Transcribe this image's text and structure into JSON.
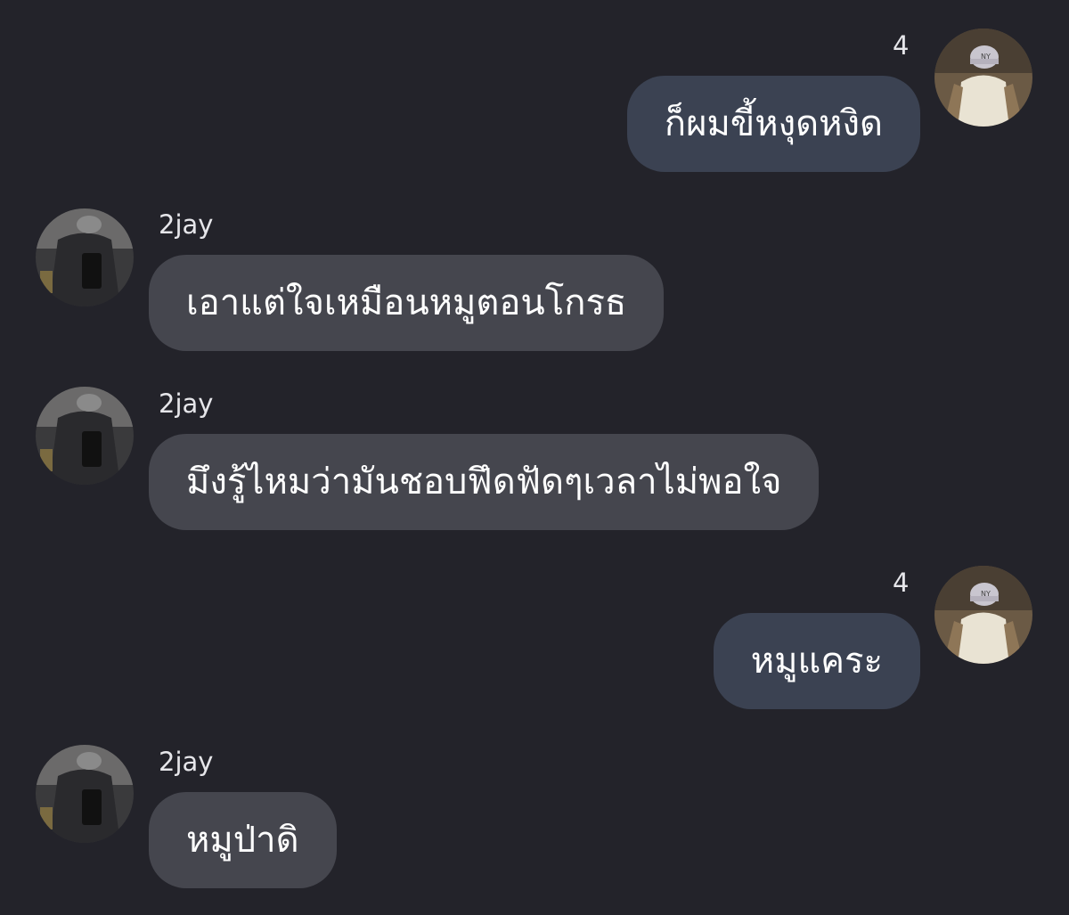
{
  "messages": [
    {
      "id": "m1",
      "side": "out",
      "sender": "4",
      "text": "ก็ผมขี้หงุดหงิด"
    },
    {
      "id": "m2",
      "side": "in",
      "sender": "2jay",
      "text": "เอาแต่ใจเหมือนหมูตอนโกรธ"
    },
    {
      "id": "m3",
      "side": "in",
      "sender": "2jay",
      "text": "มึงรู้ไหมว่ามันชอบฟึดฟัดๆเวลาไม่พอใจ"
    },
    {
      "id": "m4",
      "side": "out",
      "sender": "4",
      "text": "หมูแคระ"
    },
    {
      "id": "m5",
      "side": "in",
      "sender": "2jay",
      "text": "หมูป่าดิ"
    }
  ],
  "colors": {
    "background": "#23232a",
    "incoming_bubble": "#45464e",
    "outgoing_bubble": "#3b4252",
    "text": "#ffffff"
  }
}
